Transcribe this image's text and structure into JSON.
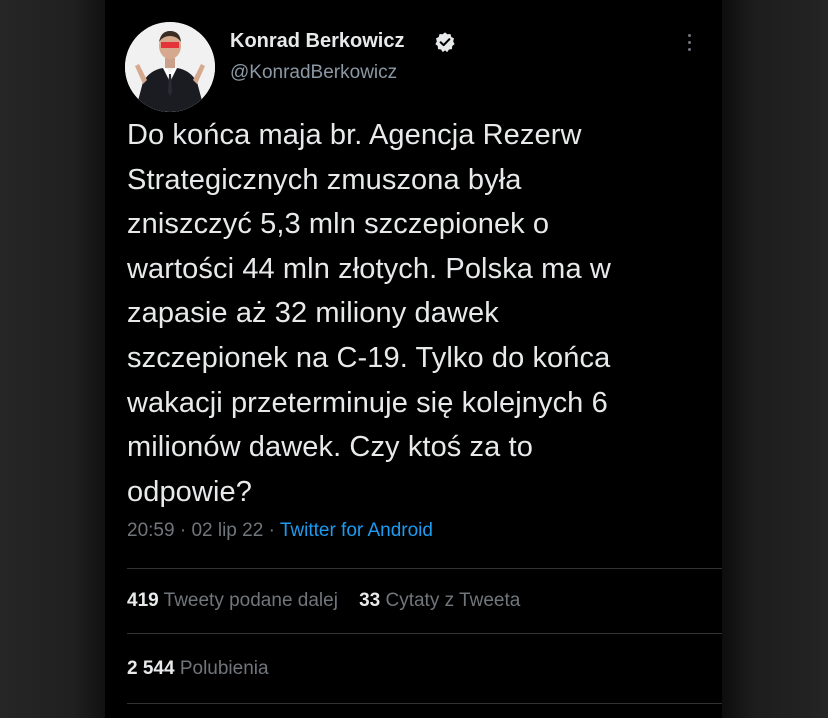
{
  "author": {
    "name": "Konrad Berkowicz",
    "handle": "@KonradBerkowicz",
    "verified": true
  },
  "tweet": {
    "text": "Do końca maja br. Agencja Rezerw\nStrategicznych zmuszona była\nzniszczyć 5,3 mln szczepionek o\nwartości 44 mln złotych. Polska ma w\nzapasie aż 32 miliony dawek\nszczepionek na C-19. Tylko do końca\nwakacji przeterminuje się kolejnych 6\nmilionów dawek. Czy ktoś za to\nodpowie?",
    "time": "20:59",
    "date": "02 lip 22",
    "separator": "·",
    "source": "Twitter for Android"
  },
  "stats": {
    "retweets_count": "419",
    "retweets_label": "Tweety podane dalej",
    "quotes_count": "33",
    "quotes_label": "Cytaty z Tweeta",
    "likes_count": "2 544",
    "likes_label": "Polubienia"
  },
  "colors": {
    "background": "#000000",
    "text": "#e7e9ea",
    "muted": "#71767b",
    "link": "#1d9bf0",
    "verified_badge": "#e7e9ea"
  },
  "icons": {
    "verified": "verified-badge-icon",
    "more": "more-options-icon"
  }
}
